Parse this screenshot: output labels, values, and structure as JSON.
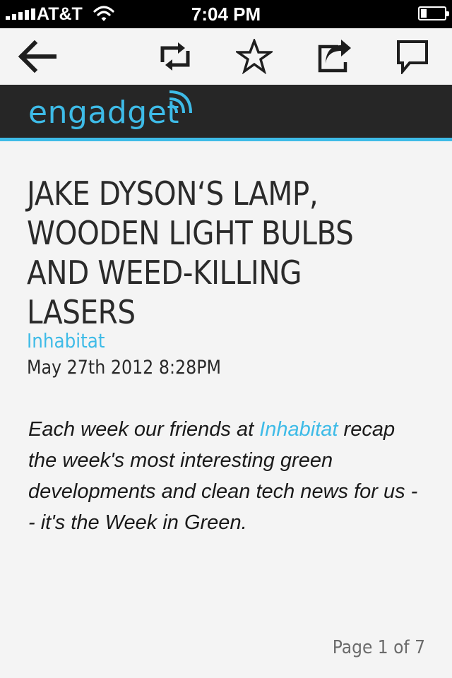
{
  "status_bar": {
    "carrier": "AT&T",
    "time": "7:04 PM",
    "battery_level": 0.25
  },
  "toolbar": {
    "icons": [
      "back-arrow-icon",
      "retweet-icon",
      "star-icon",
      "share-icon",
      "comment-icon"
    ]
  },
  "brand": {
    "logo_text": "engadget",
    "accent_color": "#3ebbe7",
    "bar_color": "#262626"
  },
  "article": {
    "headline": "JAKE DYSON‘S LAMP, WOODEN LIGHT BULBS AND WEED-KILLING LASERS",
    "source": "Inhabitat",
    "date": "May 27th 2012 8:28PM",
    "body_before_link": "Each week our friends at ",
    "body_link": "Inhabitat",
    "body_after_link": " recap the week's most interesting green developments and clean tech news for us -- it's the Week in Green."
  },
  "pagination": {
    "label": "Page 1 of 7"
  }
}
